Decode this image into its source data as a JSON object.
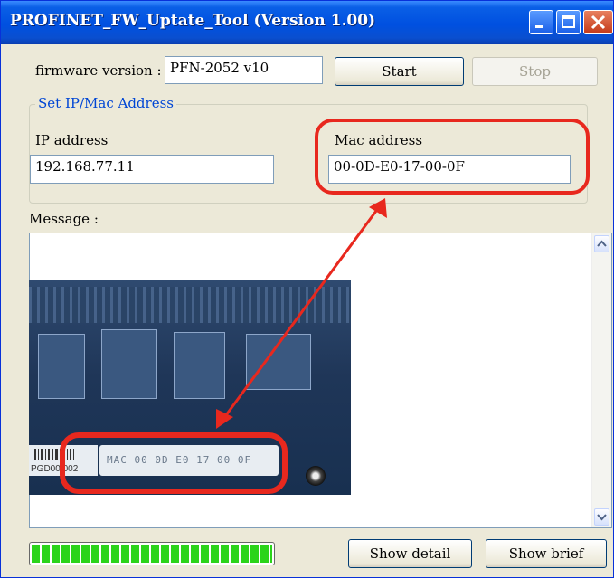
{
  "window": {
    "title": "PROFINET_FW_Uptate_Tool (Version 1.00)",
    "controls": [
      "minimize-icon",
      "maximize-icon",
      "close-icon"
    ]
  },
  "firmware": {
    "label": "firmware version :",
    "value": "PFN-2052 v10"
  },
  "buttons": {
    "start": "Start",
    "stop": "Stop",
    "show_detail": "Show detail",
    "show_brief": "Show brief"
  },
  "ip_mac_group": {
    "legend": "Set IP/Mac Address",
    "ip_label": "IP address",
    "ip_value": "192.168.77.11",
    "mac_label": "Mac address",
    "mac_value": "00-0D-E0-17-00-0F"
  },
  "message": {
    "label": "Message :",
    "photo_label_text": "MAC 00 0D E0 17 00 0F",
    "photo_barcode_text": "PGD00 002"
  },
  "progress": {
    "fraction": 1.0
  },
  "colors": {
    "highlight_red": "#e8281e",
    "progress_green": "#2bd41a",
    "titlebar_blue": "#0050e0"
  }
}
